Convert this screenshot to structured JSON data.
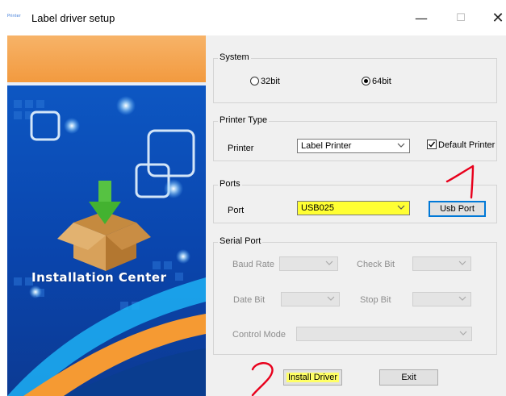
{
  "window": {
    "app_icon_text": "Printer",
    "title": "Label driver setup",
    "minimize_glyph": "—",
    "maximize_glyph": "☐",
    "close_glyph": "✕"
  },
  "banner": {
    "text": "Installation Center"
  },
  "system": {
    "title": "System",
    "options": [
      "32bit",
      "64bit"
    ],
    "selected": "64bit"
  },
  "printer_type": {
    "title": "Printer Type",
    "printer_label": "Printer",
    "printer_value": "Label Printer",
    "default_printer_label": "Default Printer",
    "default_printer_checked": true
  },
  "ports": {
    "title": "Ports",
    "port_label": "Port",
    "port_value": "USB025",
    "usb_port_button": "Usb Port"
  },
  "serial_port": {
    "title": "Serial Port",
    "baud_rate_label": "Baud Rate",
    "check_bit_label": "Check Bit",
    "date_bit_label": "Date Bit",
    "stop_bit_label": "Stop Bit",
    "control_mode_label": "Control Mode"
  },
  "footer": {
    "install_driver_button": "Install Driver",
    "exit_button": "Exit"
  },
  "annotations": {
    "mark_1": "1"
  },
  "colors": {
    "highlight": "#ffff33",
    "focus_border": "#0078d7",
    "annotation_red": "#e8001c",
    "banner_blue": "#0b49b4",
    "banner_orange": "#f5a04a"
  }
}
